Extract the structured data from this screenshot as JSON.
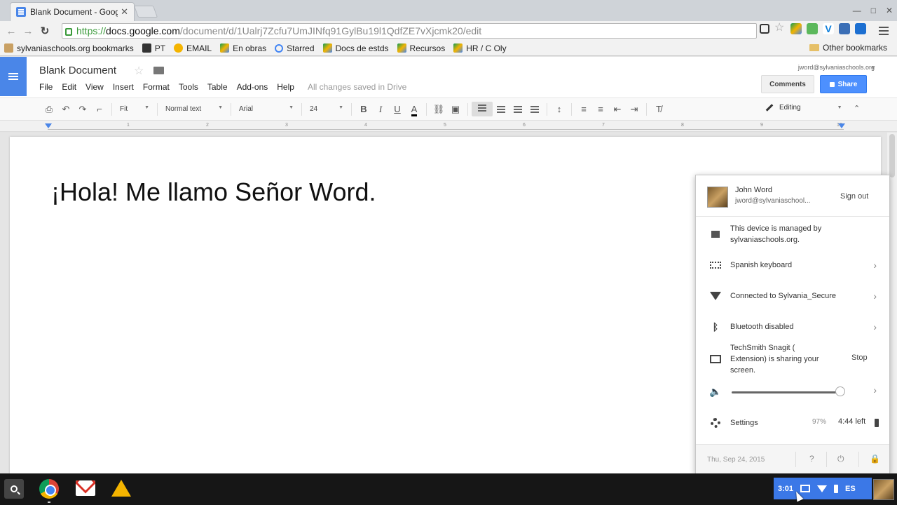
{
  "browser": {
    "tab_title": "Blank Document - Goog",
    "url_scheme": "https://",
    "url_host": "docs.google.com",
    "url_path": "/document/d/1Ualrj7Zcfu7UmJINfq91GylBu19l1QdfZE7vXjcmk20/edit",
    "bookmarks": [
      {
        "label": "sylvaniaschools.org bookmarks",
        "icon": "folder-icon",
        "color": "#c9a063"
      },
      {
        "label": "PT",
        "icon": "pt-icon",
        "color": "#333333"
      },
      {
        "label": "EMAIL",
        "icon": "email-icon",
        "color": "#f4b400"
      },
      {
        "label": "En obras",
        "icon": "drive-icon",
        "color": "#0f9d58"
      },
      {
        "label": "Starred",
        "icon": "google-icon",
        "color": "#4285f4"
      },
      {
        "label": "Docs de estds",
        "icon": "drive-icon",
        "color": "#0f9d58"
      },
      {
        "label": "Recursos",
        "icon": "drive-icon",
        "color": "#0f9d58"
      },
      {
        "label": "HR / C Oly",
        "icon": "drive-icon",
        "color": "#0f9d58"
      }
    ],
    "other_bookmarks": "Other bookmarks"
  },
  "docs": {
    "title": "Blank Document",
    "menu": [
      "File",
      "Edit",
      "View",
      "Insert",
      "Format",
      "Tools",
      "Table",
      "Add-ons",
      "Help"
    ],
    "saved_status": "All changes saved in Drive",
    "user_email": "jword@sylvaniaschools.org",
    "comments_label": "Comments",
    "share_label": "Share",
    "toolbar": {
      "zoom": "Fit",
      "style": "Normal text",
      "font": "Arial",
      "size": "24",
      "bold": "B",
      "italic": "I",
      "underline": "U",
      "text_color": "A",
      "mode": "Editing"
    },
    "ruler_numbers": [
      "1",
      "2",
      "3",
      "4",
      "5",
      "6",
      "7",
      "8",
      "9",
      "10"
    ],
    "body_text": "¡Hola! Me llamo Señor Word."
  },
  "tray": {
    "user_name": "John Word",
    "user_email": "jword@sylvaniaschool...",
    "sign_out": "Sign out",
    "managed_line1": "This device is managed by",
    "managed_line2": "sylvaniaschools.org.",
    "keyboard": "Spanish keyboard",
    "network": "Connected to Sylvania_Secure",
    "bluetooth": "Bluetooth disabled",
    "sharing_line1": "TechSmith Snagit (",
    "sharing_line2": "Extension) is sharing your",
    "sharing_line3": "screen.",
    "stop": "Stop",
    "volume": 0.97,
    "settings": "Settings",
    "battery_pct": "97%",
    "battery_left": "4:44 left",
    "date": "Thu, Sep 24, 2015",
    "help_glyph": "?"
  },
  "shelf": {
    "time": "3:01",
    "ime": "ES"
  }
}
